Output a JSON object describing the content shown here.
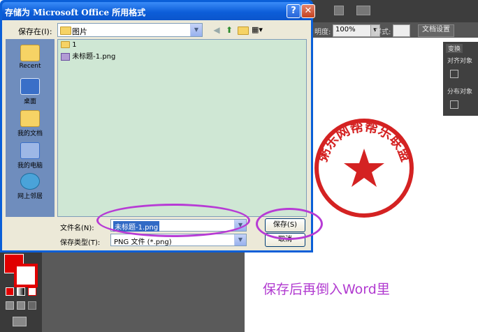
{
  "dialog": {
    "title": "存储为 Microsoft Office 所用格式",
    "help_icon": "?",
    "close_icon": "✕",
    "save_in_label": "保存在(I):",
    "save_in_value": "图片",
    "places": [
      {
        "label": "Recent",
        "icon": "recent-folder-icon"
      },
      {
        "label": "桌面",
        "icon": "desktop-icon"
      },
      {
        "label": "我的文档",
        "icon": "my-documents-icon"
      },
      {
        "label": "我的电脑",
        "icon": "my-computer-icon"
      },
      {
        "label": "网上邻居",
        "icon": "network-icon"
      }
    ],
    "files": [
      {
        "name": "1",
        "icon": "folder-icon"
      },
      {
        "name": "未标题-1.png",
        "icon": "png-file-icon"
      }
    ],
    "filename_label": "文件名(N):",
    "filename_value": "未标题-1.png",
    "filetype_label": "保存类型(T):",
    "filetype_value": "PNG 文件 (*.png)",
    "save_button": "保存(S)",
    "cancel_button": "取消"
  },
  "illustrator": {
    "opacity_label": "明度:",
    "opacity_value": "100%",
    "style_label": "样式:",
    "doc_setup_button": "文档设置",
    "panel_tab": "变换",
    "align_label": "对齐对象",
    "distribute_label": "分布对象",
    "fill_color": "#e00000"
  },
  "stamp": {
    "text": "粥乐网帮帮乐联盟",
    "color": "#d42222"
  },
  "annotation": {
    "instruction": "保存后再倒入Word里",
    "color": "#b13ad0"
  }
}
